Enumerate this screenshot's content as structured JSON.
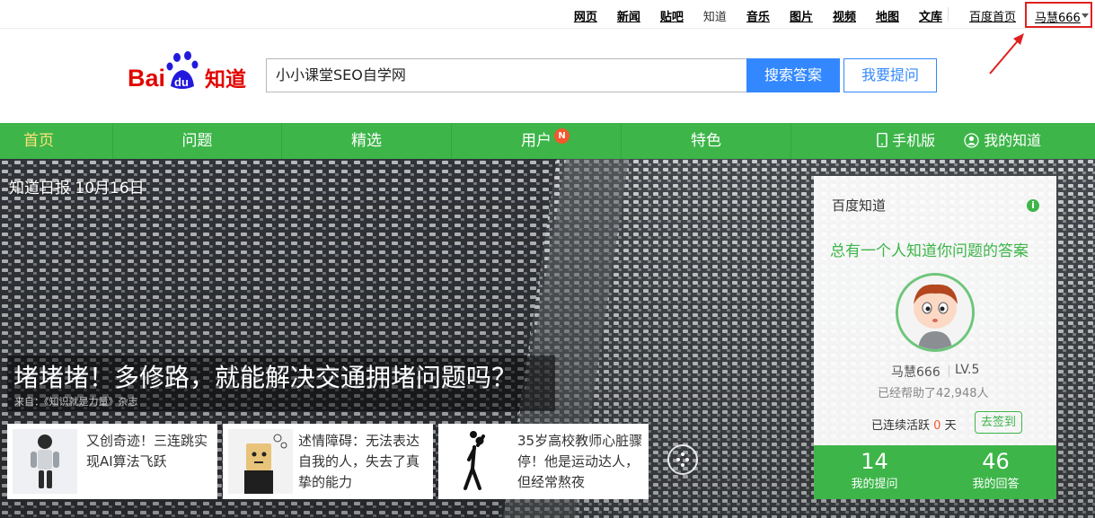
{
  "topnav": {
    "links": [
      "网页",
      "新闻",
      "贴吧",
      "知道",
      "音乐",
      "图片",
      "视频",
      "地图",
      "文库"
    ],
    "home_link": "百度首页",
    "username": "马慧666"
  },
  "header": {
    "logo_text": "Bai du 知道",
    "search_value": "小小课堂SEO自学网",
    "search_button": "搜索答案",
    "ask_button": "我要提问"
  },
  "nav": {
    "items": [
      "首页",
      "问题",
      "精选",
      "用户",
      "特色"
    ],
    "user_badge": "N",
    "mobile": "手机版",
    "my_zhidao": "我的知道"
  },
  "hero": {
    "daily": "知道日报 10月16日",
    "headline": "堵堵堵！多修路，就能解决交通拥堵问题吗？",
    "source": "来自：《知识就是力量》杂志",
    "cards": [
      {
        "text": "又创奇迹！三连跳实现AI算法飞跃"
      },
      {
        "text": "述情障碍：无法表达自我的人，失去了真挚的能力"
      },
      {
        "text": "35岁高校教师心脏骤停！他是运动达人，但经常熬夜"
      }
    ]
  },
  "panel": {
    "title": "百度知道",
    "slogan": "总有一个人知道你问题的答案",
    "username": "马慧666",
    "level": "LV.5",
    "helped": "已经帮助了42,948人",
    "streak_prefix": "已连续活跃",
    "streak_days": "0",
    "streak_suffix": "天",
    "checkin": "去签到",
    "questions_count": "14",
    "questions_label": "我的提问",
    "answers_count": "46",
    "answers_label": "我的回答"
  },
  "colors": {
    "green": "#3db549",
    "blue": "#3388ff",
    "highlight_red": "#e02020"
  }
}
